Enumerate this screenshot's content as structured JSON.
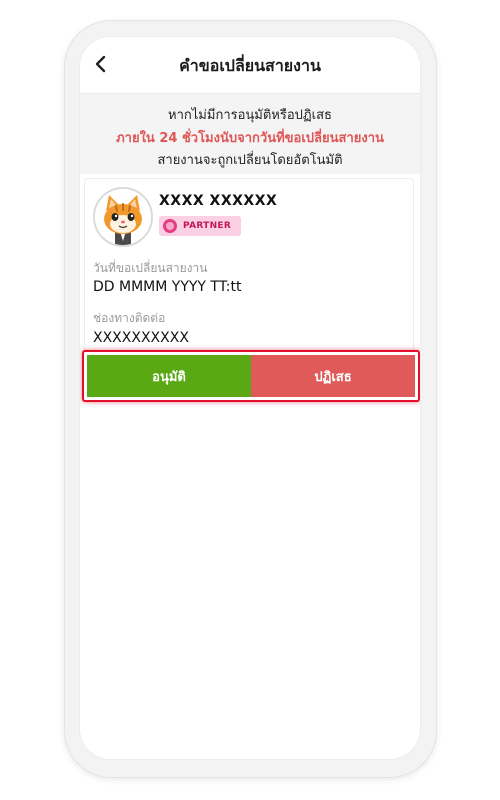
{
  "header": {
    "title": "คำขอเปลี่ยนสายงาน"
  },
  "notice": {
    "line1": "หากไม่มีการอนุมัติหรือปฏิเสธ",
    "line2": "ภายใน 24 ชั่วโมงนับจากวันที่ขอเปลี่ยนสายงาน",
    "line3": "สายงานจะถูกเปลี่ยนโดยอัตโนมัติ"
  },
  "card": {
    "name": "XXXX  XXXXXX",
    "badge": "PARTNER",
    "date_label": "วันที่ขอเปลี่ยนสายงาน",
    "date_value": "DD MMMM YYYY TT:tt",
    "contact_label": "ช่องทางติดต่อ",
    "contact_value": "XXXXXXXXXX"
  },
  "actions": {
    "approve": "อนุมัติ",
    "reject": "ปฏิเสธ"
  },
  "colors": {
    "approve": "#5aa914",
    "reject": "#e05a5a",
    "highlight": "#e0112a",
    "notice_red": "#e05555",
    "badge_bg": "#fbd0e3"
  },
  "icons": {
    "back": "chevron-left-icon",
    "avatar": "cat-avatar-icon",
    "badge": "partner-badge-icon"
  }
}
